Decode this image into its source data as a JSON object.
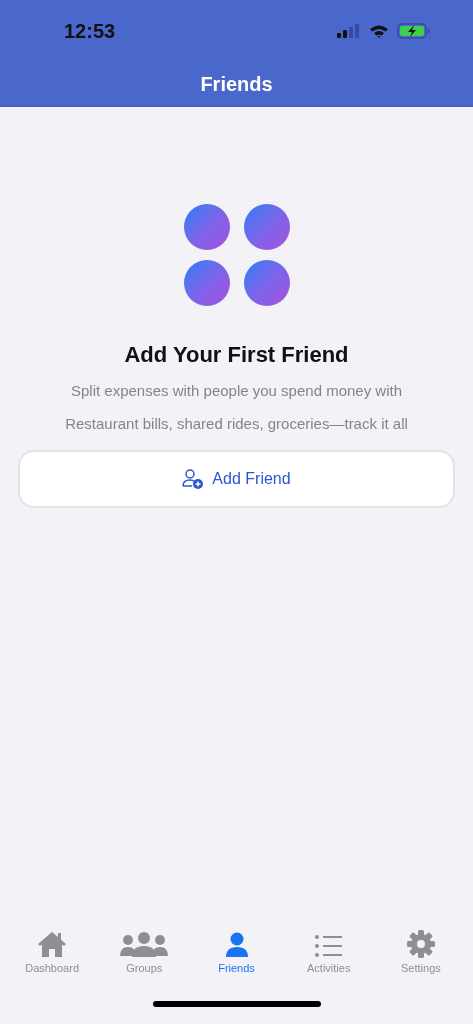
{
  "status_bar": {
    "time": "12:53"
  },
  "nav_bar": {
    "title": "Friends"
  },
  "empty_state": {
    "title": "Add Your First Friend",
    "lines": [
      "Split expenses with people you spend money with",
      "Restaurant bills, shared rides, groceries—track it all"
    ],
    "button": "Add Friend"
  },
  "tab_bar": [
    {
      "kind": "home",
      "label": "Dashboard",
      "selected": false
    },
    {
      "kind": "groups",
      "label": "Groups",
      "selected": false
    },
    {
      "kind": "person",
      "label": "Friends",
      "selected": true
    },
    {
      "kind": "list",
      "label": "Activities",
      "selected": false
    },
    {
      "kind": "gear",
      "label": "Settings",
      "selected": false
    }
  ]
}
